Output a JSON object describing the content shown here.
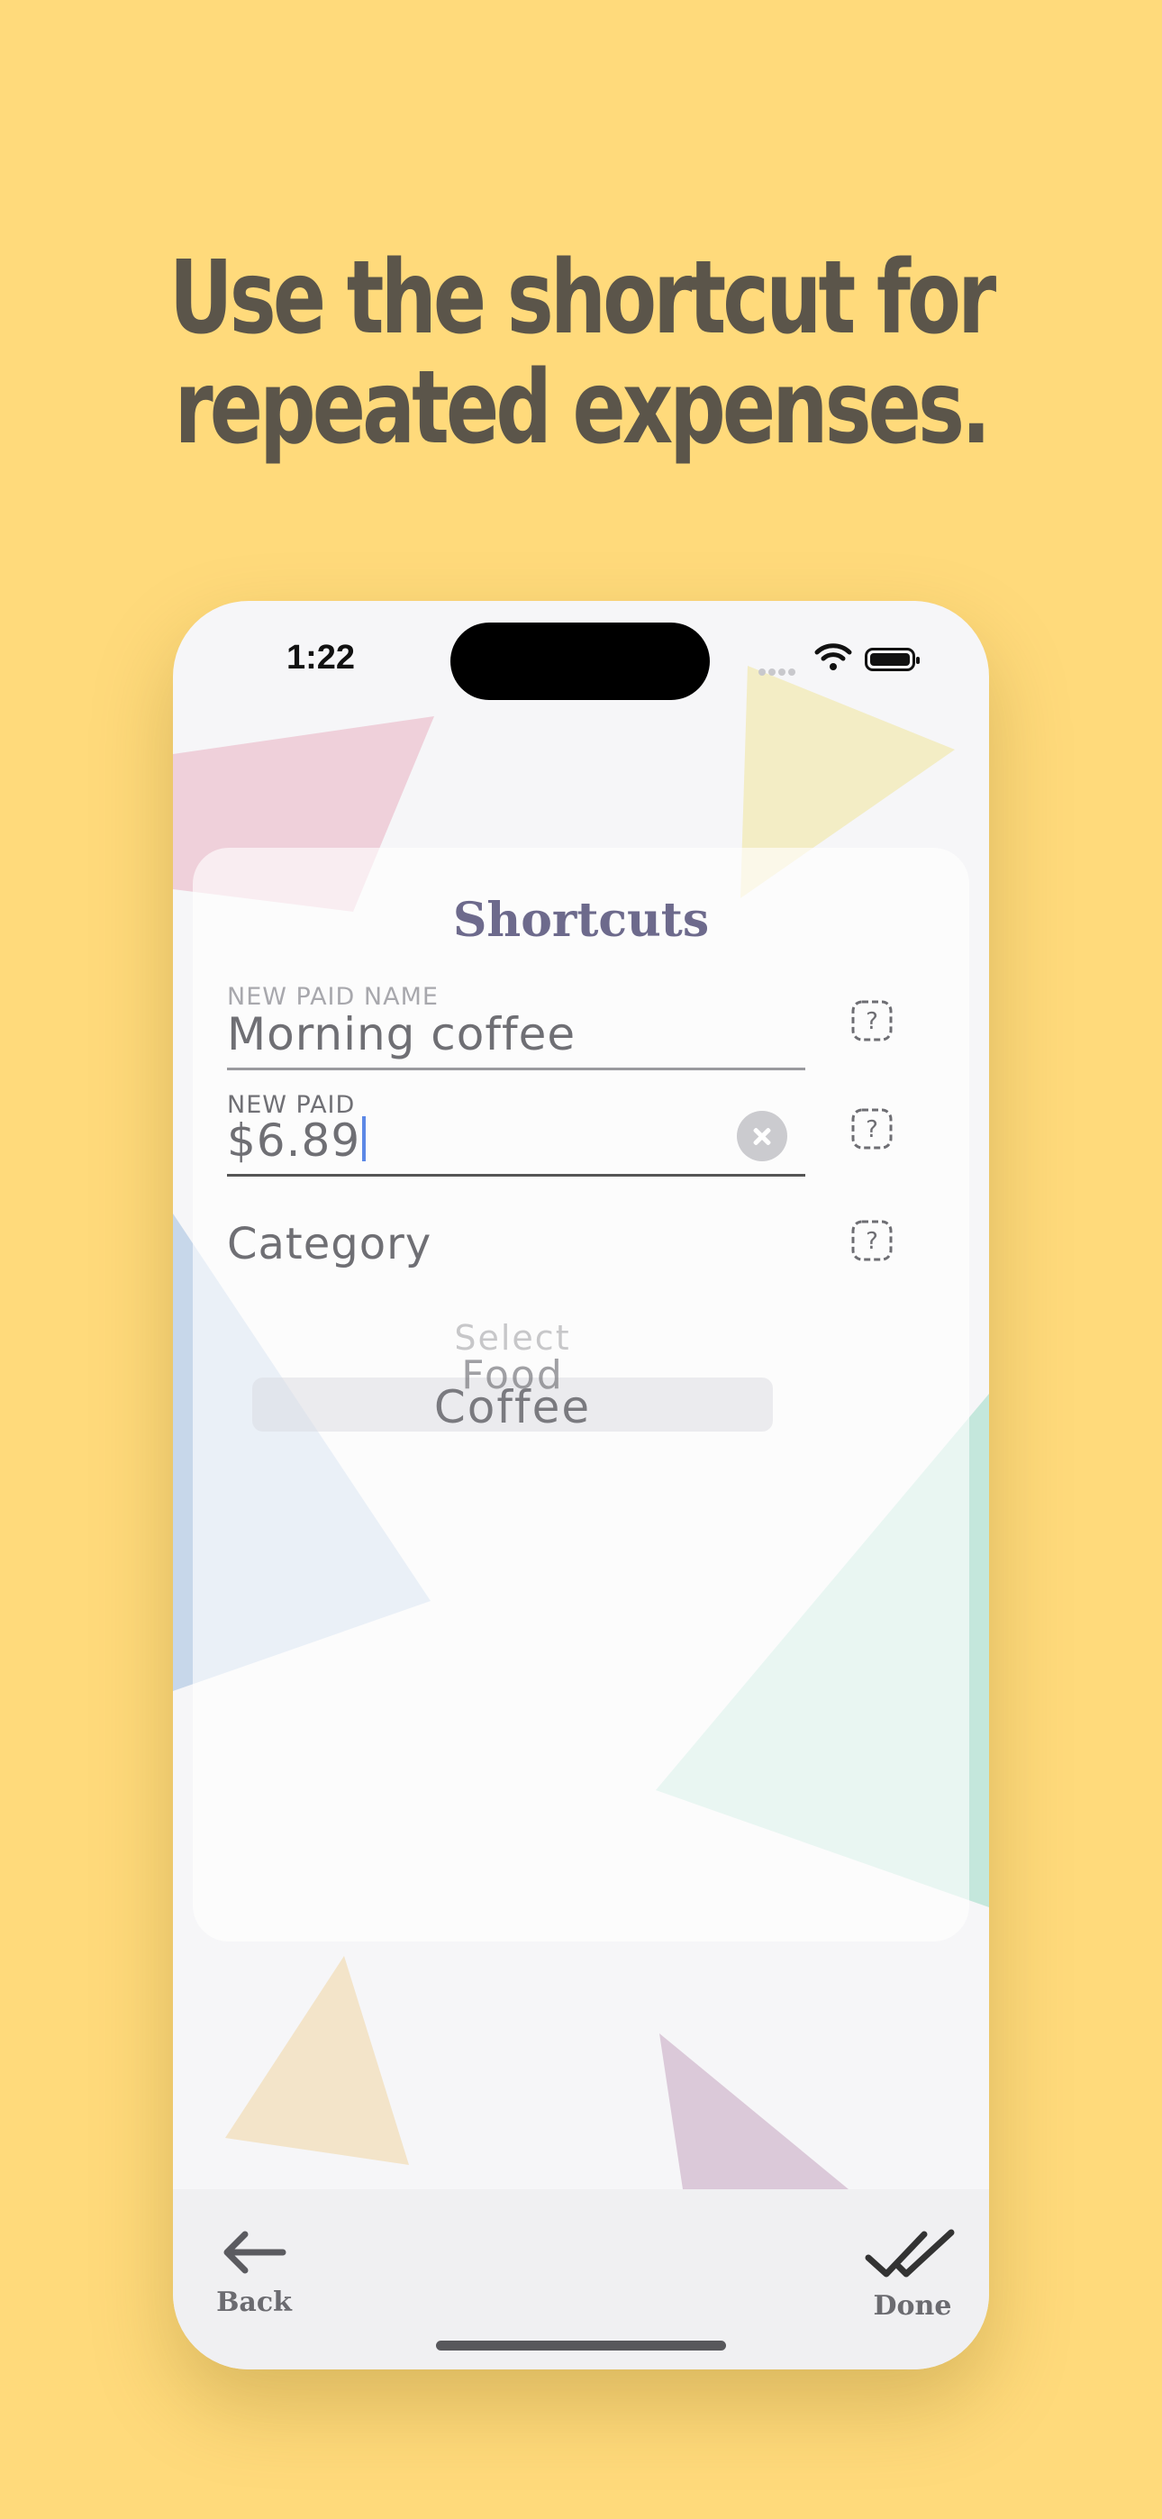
{
  "headline": {
    "line1": "Use the shortcut for",
    "line2": "repeated expenses."
  },
  "status_bar": {
    "time": "1:22"
  },
  "sheet": {
    "title": "Shortcuts",
    "name_field": {
      "label": "NEW PAID NAME",
      "value": "Morning coffee"
    },
    "amount_field": {
      "label": "NEW PAID",
      "value": "$6.89"
    },
    "category": {
      "label": "Category",
      "picker_options": [
        "Select",
        "Food",
        "Coffee"
      ],
      "selected": "Coffee"
    }
  },
  "toolbar": {
    "back_label": "Back",
    "done_label": "Done"
  },
  "icons": {
    "help": "help-icon",
    "clear": "clear-icon",
    "back": "back-arrow-icon",
    "done": "double-check-icon"
  },
  "colors": {
    "background": "#FFDA7B",
    "headline": "#5b554a",
    "title": "#6d6a8c",
    "caret": "#5c88e6"
  }
}
